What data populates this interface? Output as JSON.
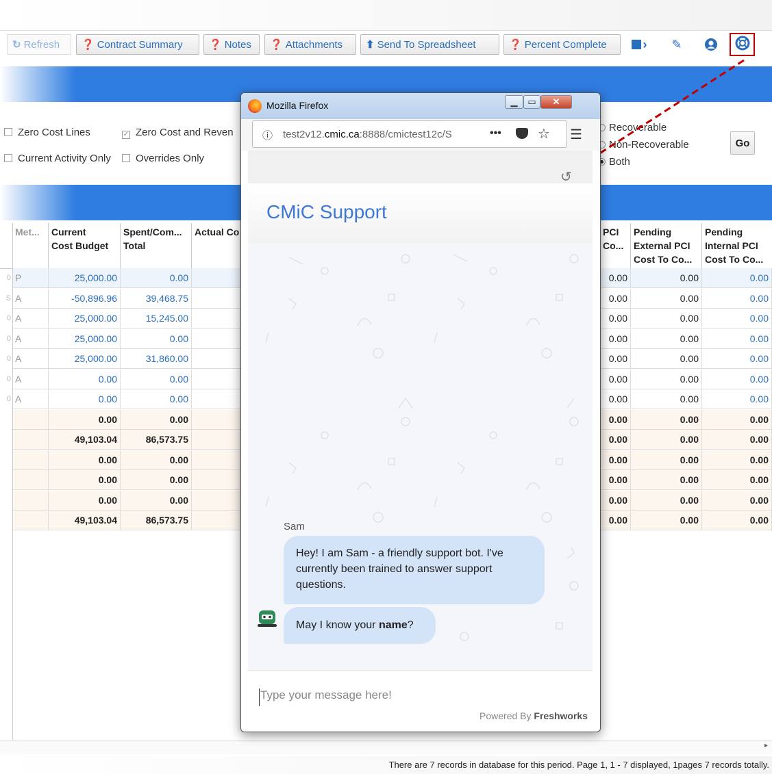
{
  "toolbar": {
    "refresh": "Refresh",
    "contract_summary": "Contract Summary",
    "notes": "Notes",
    "attachments": "Attachments",
    "send_to_spreadsheet": "Send To Spreadsheet",
    "percent_complete": "Percent Complete",
    "icons": [
      "refresh-icon",
      "help-icon",
      "upload-icon",
      "save-icon",
      "edit-icon",
      "user-icon",
      "lifebuoy-icon"
    ]
  },
  "filters": {
    "zero_cost_lines": "Zero Cost Lines",
    "zero_cost_and_revenue": "Zero Cost and Reven",
    "current_activity_only": "Current Activity Only",
    "overrides_only": "Overrides Only",
    "recoverable": "Recoverable",
    "non_recoverable": "Non-Recoverable",
    "both": "Both",
    "go": "Go"
  },
  "grid": {
    "headers": {
      "met": "Met...",
      "current_cost_budget": [
        "Current",
        "Cost Budget"
      ],
      "spent_committed_total": [
        "Spent/Com...",
        "Total"
      ],
      "actual_cost": "Actual Co",
      "pci_cost": [
        "PCI",
        "Co..."
      ],
      "pending_external": [
        "Pending",
        "External PCI",
        "Cost To Co..."
      ],
      "pending_internal": [
        "Pending",
        "Internal PCI",
        "Cost To Co..."
      ]
    },
    "rows": [
      {
        "gutter": "0",
        "met": "P",
        "budget": "25,000.00",
        "spent": "0.00",
        "pci": "0.00",
        "ext": "0.00",
        "int": "0.00",
        "style": "blue"
      },
      {
        "gutter": "S",
        "met": "A",
        "budget": "-50,896.96",
        "spent": "39,468.75",
        "pci": "0.00",
        "ext": "0.00",
        "int": "0.00",
        "style": "blue"
      },
      {
        "gutter": "0",
        "met": "A",
        "budget": "25,000.00",
        "spent": "15,245.00",
        "pci": "0.00",
        "ext": "0.00",
        "int": "0.00",
        "style": "blue"
      },
      {
        "gutter": "0",
        "met": "A",
        "budget": "25,000.00",
        "spent": "0.00",
        "pci": "0.00",
        "ext": "0.00",
        "int": "0.00",
        "style": "blue"
      },
      {
        "gutter": "0",
        "met": "A",
        "budget": "25,000.00",
        "spent": "31,860.00",
        "pci": "0.00",
        "ext": "0.00",
        "int": "0.00",
        "style": "blue"
      },
      {
        "gutter": "0",
        "met": "A",
        "budget": "0.00",
        "spent": "0.00",
        "pci": "0.00",
        "ext": "0.00",
        "int": "0.00",
        "style": "blue"
      },
      {
        "gutter": "0",
        "met": "A",
        "budget": "0.00",
        "spent": "0.00",
        "pci": "0.00",
        "ext": "0.00",
        "int": "0.00",
        "style": "blue"
      },
      {
        "gutter": "",
        "met": "",
        "budget": "0.00",
        "spent": "0.00",
        "pci": "0.00",
        "ext": "0.00",
        "int": "0.00",
        "style": "bold"
      },
      {
        "gutter": "",
        "met": "",
        "budget": "49,103.04",
        "spent": "86,573.75",
        "pci": "0.00",
        "ext": "0.00",
        "int": "0.00",
        "style": "bold"
      },
      {
        "gutter": "",
        "met": "",
        "budget": "0.00",
        "spent": "0.00",
        "pci": "0.00",
        "ext": "0.00",
        "int": "0.00",
        "style": "bold"
      },
      {
        "gutter": "",
        "met": "",
        "budget": "0.00",
        "spent": "0.00",
        "pci": "0.00",
        "ext": "0.00",
        "int": "0.00",
        "style": "bold"
      },
      {
        "gutter": "",
        "met": "",
        "budget": "0.00",
        "spent": "0.00",
        "pci": "0.00",
        "ext": "0.00",
        "int": "0.00",
        "style": "bold"
      },
      {
        "gutter": "",
        "met": "",
        "budget": "49,103.04",
        "spent": "86,573.75",
        "pci": "0.00",
        "ext": "0.00",
        "int": "0.00",
        "style": "bold"
      }
    ]
  },
  "popup": {
    "window_title": "Mozilla Firefox",
    "url_host": "test2v12.",
    "url_domain": "cmic.ca",
    "url_rest": ":8888/cmictest12c/S",
    "chat_title": "CMiC Support",
    "sender": "Sam",
    "message1": "Hey! I am Sam - a friendly support bot. I've currently been trained to answer support questions.",
    "message2_prefix": "May I know your ",
    "message2_bold": "name",
    "message2_suffix": "?",
    "input_placeholder": "Type your message here!",
    "powered_by": "Powered By ",
    "powered_brand": "Freshworks"
  },
  "status": {
    "text": "There are 7 records in database for this period.  Page 1, 1 - 7 displayed, 1pages 7 records totally."
  },
  "colors": {
    "accent_blue": "#2f7de1",
    "link_blue": "#2a6ebb",
    "highlight_red": "#c00000"
  }
}
